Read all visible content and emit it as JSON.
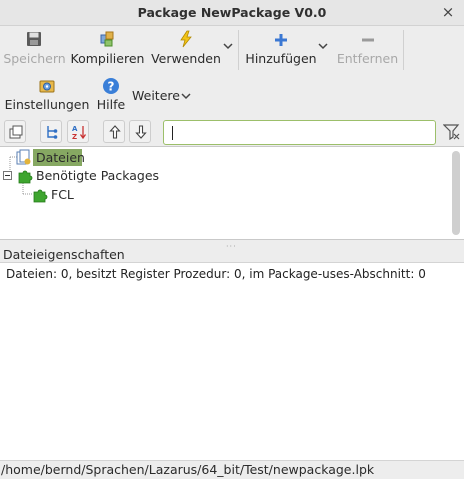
{
  "window": {
    "title": "Package NewPackage V0.0",
    "close_glyph": "×"
  },
  "toolbar": {
    "save": {
      "label": "Speichern",
      "icon": "floppy-disk-icon",
      "enabled": false
    },
    "compile": {
      "label": "Kompilieren",
      "icon": "compile-icon"
    },
    "use": {
      "label": "Verwenden",
      "icon": "lightning-icon"
    },
    "add": {
      "label": "Hinzufügen",
      "icon": "plus-icon"
    },
    "remove": {
      "label": "Entfernen",
      "icon": "minus-icon",
      "enabled": false
    },
    "options": {
      "label": "Einstellungen",
      "icon": "options-icon"
    },
    "help": {
      "label": "Hilfe",
      "icon": "help-icon"
    },
    "more": {
      "label": "Weitere"
    }
  },
  "filter": {
    "value": ""
  },
  "tree": {
    "items": [
      {
        "label": "Dateien",
        "icon": "files-icon",
        "selected": true
      },
      {
        "label": "Benötigte Packages",
        "icon": "puzzle-icon",
        "expanded": true
      },
      {
        "label": "FCL",
        "icon": "puzzle-icon"
      }
    ]
  },
  "properties": {
    "header": "Dateieigenschaften",
    "text": "Dateien: 0, besitzt Register Prozedur: 0, im Package-uses-Abschnitt: 0"
  },
  "status": {
    "path": "/home/bernd/Sprachen/Lazarus/64_bit/Test/newpackage.lpk"
  },
  "colors": {
    "selection": "#86a862",
    "filter_border": "#9cbf6a",
    "puzzle_green": "#3ea52f"
  }
}
